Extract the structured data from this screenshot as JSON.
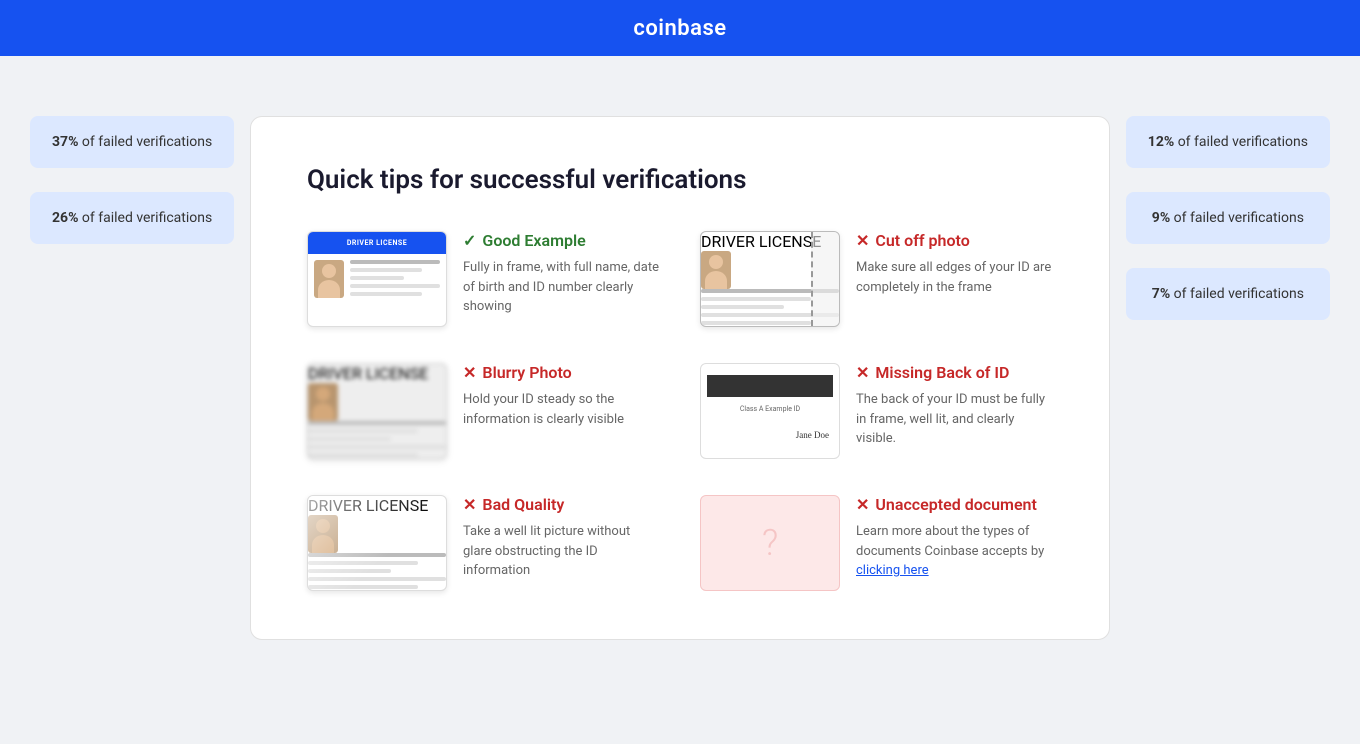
{
  "header": {
    "logo": "coinbase"
  },
  "left_panel": {
    "badges": [
      {
        "percent": "37%",
        "text": "of failed verifications"
      },
      {
        "percent": "26%",
        "text": "of failed verifications"
      }
    ]
  },
  "right_panel": {
    "badges": [
      {
        "percent": "12%",
        "text": "of failed verifications"
      },
      {
        "percent": "9%",
        "text": "of failed verifications"
      },
      {
        "percent": "7%",
        "text": "of failed verifications"
      }
    ]
  },
  "main_card": {
    "title": "Quick tips for successful verifications",
    "tips": [
      {
        "id": "good-example",
        "type": "good",
        "icon": "✓",
        "title": "Good Example",
        "description": "Fully in frame, with full name, date of birth and ID number clearly showing",
        "card_type": "good"
      },
      {
        "id": "cut-off-photo",
        "type": "bad",
        "icon": "✕",
        "title": "Cut off photo",
        "description": "Make sure all edges of your ID are completely in the frame",
        "card_type": "cutoff"
      },
      {
        "id": "blurry-photo",
        "type": "bad",
        "icon": "✕",
        "title": "Blurry Photo",
        "description": "Hold your ID steady so the information is clearly visible",
        "card_type": "blurry"
      },
      {
        "id": "missing-back-of-id",
        "type": "bad",
        "icon": "✕",
        "title": "Missing Back of ID",
        "description": "The back of your ID must be fully in frame, well lit, and clearly visible.",
        "card_type": "back"
      },
      {
        "id": "bad-quality",
        "type": "bad",
        "icon": "✕",
        "title": "Bad Quality",
        "description": "Take a well lit picture without glare obstructing the ID information",
        "card_type": "bad-quality"
      },
      {
        "id": "unaccepted-document",
        "type": "bad",
        "icon": "✕",
        "title": "Unaccepted document",
        "description": "Learn more about the types of documents Coinbase accepts by ",
        "link_text": "clicking here",
        "card_type": "unaccepted"
      }
    ],
    "card_header_text": "DRIVER LICENSE",
    "back_label": "Class A Example ID"
  }
}
